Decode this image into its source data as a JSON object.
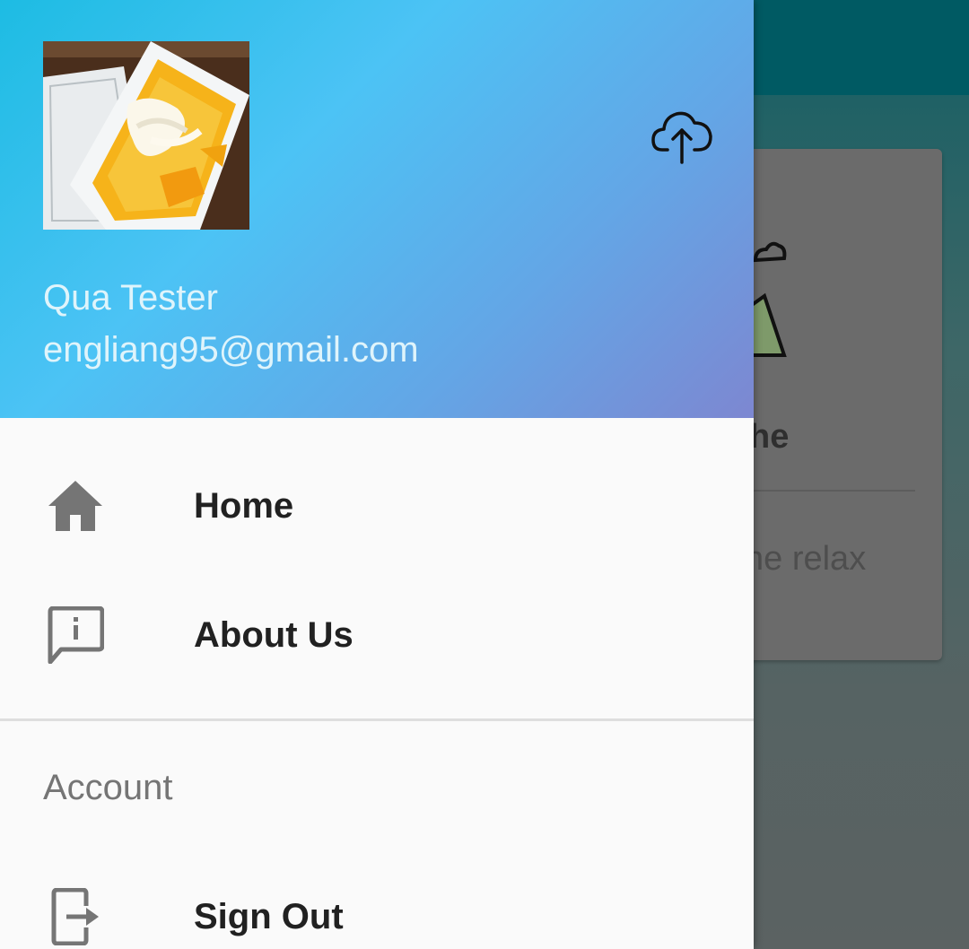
{
  "background": {
    "card_title_fragment": "he",
    "card_text_fragment": "ne relax"
  },
  "drawer": {
    "header": {
      "user_name": "Qua Tester",
      "user_email": "engliang95@gmail.com",
      "avatar_icon": "profile-photo",
      "upload_icon": "cloud-upload-icon"
    },
    "menu": [
      {
        "label": "Home",
        "icon": "home-icon"
      },
      {
        "label": "About Us",
        "icon": "info-message-icon"
      }
    ],
    "account_section": {
      "title": "Account",
      "items": [
        {
          "label": "Sign Out",
          "icon": "exit-icon"
        }
      ]
    }
  },
  "colors": {
    "header_gradient_start": "#1dbce3",
    "header_gradient_end": "#7d87d1",
    "topbar": "#005a63",
    "icon_gray": "#757575"
  }
}
